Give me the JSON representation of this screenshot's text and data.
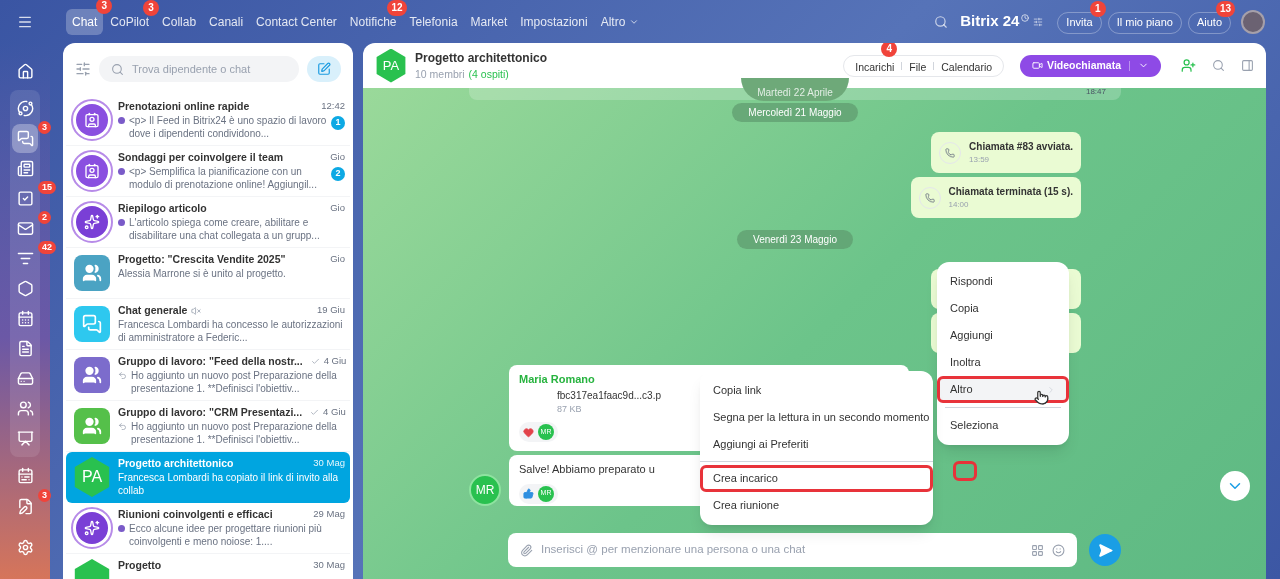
{
  "top_nav": {
    "menu": [
      {
        "label": "Chat",
        "selected": true,
        "badge": "3",
        "dropdown": false
      },
      {
        "label": "CoPilot",
        "selected": false,
        "badge": "3",
        "dropdown": false
      },
      {
        "label": "Collab",
        "selected": false,
        "dropdown": false
      },
      {
        "label": "Canali",
        "selected": false,
        "dropdown": false
      },
      {
        "label": "Contact Center",
        "selected": false,
        "dropdown": false
      },
      {
        "label": "Notifiche",
        "selected": false,
        "badge": "12",
        "dropdown": false
      },
      {
        "label": "Telefonia",
        "selected": false,
        "dropdown": false
      },
      {
        "label": "Market",
        "selected": false,
        "dropdown": false
      },
      {
        "label": "Impostazioni",
        "selected": false,
        "dropdown": false
      },
      {
        "label": "Altro",
        "selected": false,
        "dropdown": true
      }
    ],
    "logo": "Bitrix 24",
    "buttons": [
      {
        "label": "Invita",
        "badge": "1"
      },
      {
        "label": "Il mio piano"
      },
      {
        "label": "Aiuto",
        "badge": "13"
      }
    ]
  },
  "sidebar": {
    "top": [
      {
        "kind": "home",
        "selected": false
      }
    ],
    "group": [
      {
        "kind": "orbit",
        "selected": false
      },
      {
        "kind": "chat",
        "selected": true,
        "badge": "3"
      },
      {
        "kind": "feed",
        "selected": false
      },
      {
        "kind": "tasks",
        "selected": false,
        "badge": "15"
      },
      {
        "kind": "mail",
        "selected": false,
        "badge": "2"
      },
      {
        "kind": "filter",
        "selected": false,
        "badge": "42"
      },
      {
        "kind": "hexagon",
        "selected": false
      },
      {
        "kind": "calendar",
        "selected": false
      },
      {
        "kind": "document",
        "selected": false
      },
      {
        "kind": "drive",
        "selected": false
      },
      {
        "kind": "people",
        "selected": false
      },
      {
        "kind": "presentation",
        "selected": false
      }
    ],
    "bottom": [
      {
        "kind": "schedule",
        "selected": false
      },
      {
        "kind": "sign",
        "selected": false,
        "badge": "3"
      },
      {
        "kind": "settings",
        "selected": false
      }
    ]
  },
  "chat_list": {
    "search": {
      "placeholder": "Trova dipendente o chat"
    },
    "items": [
      {
        "title": "Prenotazioni online rapide",
        "time": "12:42",
        "kind": "bot_post",
        "preview": "<p> Il Feed in Bitrix24 è uno spazio di lavoro dove i dipendenti condividono...",
        "unread": "1",
        "selected": false,
        "avatar": {
          "kind": "form"
        }
      },
      {
        "title": "Sondaggi per coinvolgere il team",
        "time": "Gio",
        "kind": "bot_post",
        "preview": "<p> Semplifica la pianificazione con un modulo di prenotazione online! Aggiungil...",
        "unread": "2",
        "selected": false,
        "avatar": {
          "kind": "form"
        }
      },
      {
        "title": "Riepilogo articolo",
        "time": "Gio",
        "kind": "bot_post",
        "preview": "L'articolo spiega come creare, abilitare e disabilitare una chat collegata a un grupp...",
        "selected": false,
        "avatar": {
          "kind": "spark"
        }
      },
      {
        "title": "Progetto: \"Crescita Vendite 2025\"",
        "time": "Gio",
        "kind": "plain",
        "preview": "Alessia Marrone si è unito al progetto.",
        "selected": false,
        "avatar": {
          "kind": "group",
          "color": "#4ba3c3"
        }
      },
      {
        "title": "Chat generale",
        "time": "19 Giu",
        "kind": "plain",
        "muted": true,
        "preview": "Francesca Lombardi ha concesso le autorizzazioni di amministratore a Federic...",
        "selected": false,
        "avatar": {
          "kind": "chat"
        }
      },
      {
        "title": "Gruppo di lavoro: \"Feed della nostr...",
        "time": "4 Giu",
        "kind": "reply",
        "read": true,
        "preview": "Ho aggiunto un nuovo post Preparazione della presentazione 1. **Definisci l'obiettiv...",
        "selected": false,
        "avatar": {
          "kind": "group",
          "color": "#7c6ccc"
        }
      },
      {
        "title": "Gruppo di lavoro: \"CRM Presentazi...",
        "time": "4 Giu",
        "kind": "reply",
        "read": true,
        "preview": "Ho aggiunto un nuovo post Preparazione della presentazione 1. **Definisci l'obiettiv...",
        "selected": false,
        "avatar": {
          "kind": "group",
          "color": "#55c04a"
        }
      },
      {
        "title": "Progetto architettonico",
        "time": "30 Mag",
        "kind": "plain",
        "preview": "Francesca Lombardi ha copiato il link di invito alla collab",
        "selected": true,
        "avatar": {
          "kind": "initials",
          "initials": "PA"
        }
      },
      {
        "title": "Riunioni coinvolgenti e efficaci",
        "time": "29 Mag",
        "kind": "bot_post",
        "preview": "Ecco alcune idee per progettare riunioni più coinvolgenti e meno noiose: 1....",
        "selected": false,
        "avatar": {
          "kind": "spark"
        }
      },
      {
        "title": "Progetto",
        "time": "30 Mag",
        "selected": false,
        "avatar": {
          "kind": "initials"
        }
      }
    ]
  },
  "chat": {
    "title": "Progetto architettonico",
    "initials": "PA",
    "members": "10 membri",
    "guests": "(4 ospiti)",
    "tabs": [
      {
        "label": "Incarichi",
        "badge": "4"
      },
      {
        "label": "File"
      },
      {
        "label": "Calendario"
      }
    ],
    "call_button": "Videochiamata",
    "messages": [
      {
        "kind": "date",
        "text": "Martedì 22 Aprile",
        "time": "18:47"
      },
      {
        "kind": "date",
        "text": "Mercoledì 21 Maggio"
      },
      {
        "kind": "call",
        "text": "Chiamata #83 avviata.",
        "time": "13:59"
      },
      {
        "kind": "call",
        "text": "Chiamata terminata (15 s).",
        "time": "14:00"
      },
      {
        "kind": "date",
        "text": "Venerdì 23 Maggio"
      },
      {
        "kind": "hidden_call"
      },
      {
        "kind": "hidden_call"
      },
      {
        "kind": "file",
        "author": "Maria Romano",
        "file": "fbc317ea1faac9d...c3.p",
        "size": "87 KB",
        "reaction": {
          "kind": "heart"
        },
        "reader": "MR"
      },
      {
        "kind": "text",
        "text": "Salve! Abbiamo preparato u",
        "reaction": {
          "kind": "like"
        },
        "reader": "MR",
        "avatar": "MR"
      }
    ],
    "more_menu": [
      {
        "label": "Copia link",
        "highlighted": false
      },
      {
        "label": "Segna per la lettura in un secondo momento",
        "highlighted": false
      },
      {
        "label": "Aggiungi ai Preferiti",
        "highlighted": false
      },
      {
        "label": "Crea incarico",
        "highlighted": true,
        "divider": true
      },
      {
        "label": "Crea riunione",
        "highlighted": false
      }
    ],
    "context_menu": [
      {
        "label": "Rispondi",
        "selected": false,
        "highlighted": false,
        "submenu": false
      },
      {
        "label": "Copia",
        "selected": false,
        "highlighted": false,
        "submenu": false
      },
      {
        "label": "Aggiungi",
        "selected": false,
        "highlighted": false,
        "submenu": false
      },
      {
        "label": "Inoltra",
        "selected": false,
        "highlighted": false,
        "submenu": false
      },
      {
        "label": "Altro",
        "selected": true,
        "highlighted": true,
        "submenu": true
      },
      {
        "label": "Seleziona",
        "selected": false,
        "highlighted": false,
        "submenu": false,
        "divider": true
      }
    ],
    "menu_button": {
      "highlighted": true
    },
    "composer": {
      "placeholder": "Inserisci @ per menzionare una persona o una chat"
    }
  }
}
